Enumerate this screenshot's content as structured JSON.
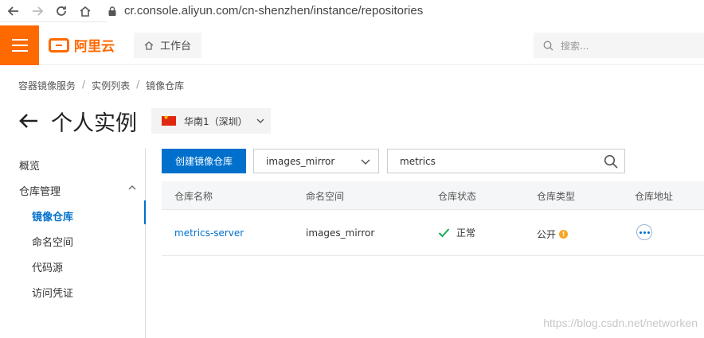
{
  "browser": {
    "url": "cr.console.aliyun.com/cn-shenzhen/instance/repositories"
  },
  "header": {
    "logo_text": "阿里云",
    "workbench_label": "工作台",
    "search_placeholder": "搜索..."
  },
  "breadcrumb": [
    "容器镜像服务",
    "实例列表",
    "镜像仓库"
  ],
  "page": {
    "title": "个人实例",
    "region": "华南1（深圳）"
  },
  "sidebar": {
    "items": [
      {
        "label": "概览"
      },
      {
        "label": "仓库管理"
      },
      {
        "label": "镜像仓库"
      },
      {
        "label": "命名空间"
      },
      {
        "label": "代码源"
      },
      {
        "label": "访问凭证"
      }
    ]
  },
  "toolbar": {
    "create_label": "创建镜像仓库",
    "namespace_value": "images_mirror",
    "search_value": "metrics"
  },
  "table": {
    "columns": [
      "仓库名称",
      "命名空间",
      "仓库状态",
      "仓库类型",
      "仓库地址"
    ],
    "rows": [
      {
        "name": "metrics-server",
        "namespace": "images_mirror",
        "status": "正常",
        "type": "公开"
      }
    ]
  },
  "watermark": "https://blog.csdn.net/networken",
  "colors": {
    "accent": "#0070cc",
    "brand": "#ff6a00",
    "success": "#1aaa55",
    "warning": "#f5a623"
  }
}
